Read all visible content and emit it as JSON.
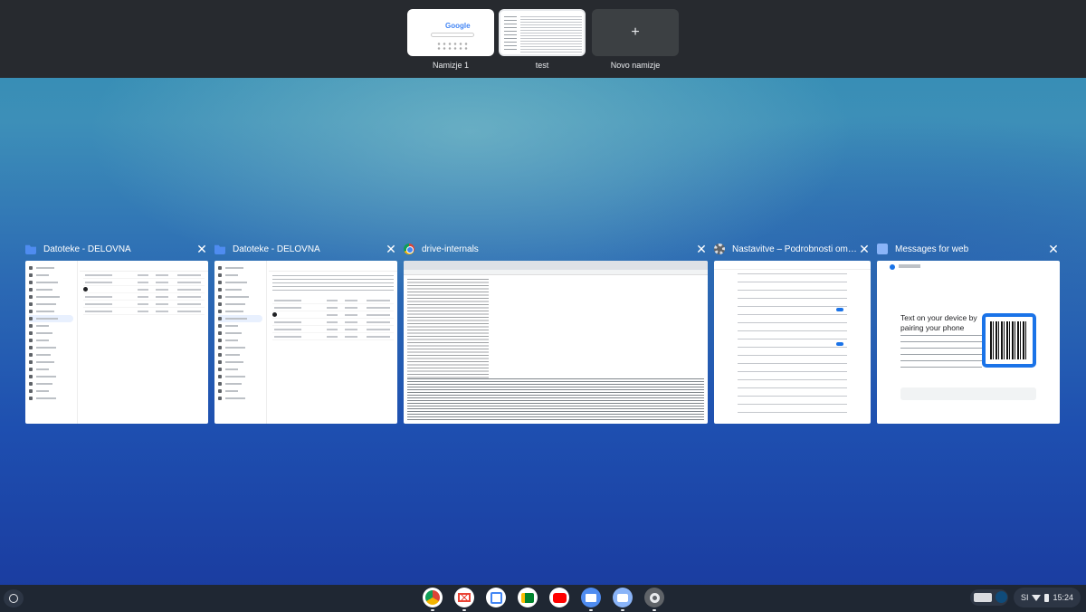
{
  "desks": {
    "items": [
      {
        "label": "Namizje 1"
      },
      {
        "label": "test"
      },
      {
        "label": "Novo namizje",
        "icon": "+"
      }
    ]
  },
  "windows": [
    {
      "title": "Datoteke - DELOVNA",
      "icon": "folder-icon",
      "close": "✕"
    },
    {
      "title": "Datoteke - DELOVNA",
      "icon": "folder-icon",
      "close": "✕"
    },
    {
      "title": "drive-internals",
      "icon": "chrome-icon",
      "close": "✕"
    },
    {
      "title": "Nastavitve – Podrobnosti omre...",
      "icon": "settings-icon",
      "close": "✕"
    },
    {
      "title": "Messages for web",
      "icon": "messages-icon",
      "close": "✕"
    }
  ],
  "messages_preview": {
    "heading": "Text on your device by pairing your phone"
  },
  "shelf": {
    "apps": [
      {
        "name": "chrome",
        "color": "#ffffff"
      },
      {
        "name": "gmail",
        "color": "#ffffff"
      },
      {
        "name": "calendar",
        "color": "#ffffff"
      },
      {
        "name": "meet",
        "color": "#ffffff"
      },
      {
        "name": "youtube",
        "color": "#ffffff"
      },
      {
        "name": "files",
        "color": "#4f8cf0"
      },
      {
        "name": "messages",
        "color": "#8ab4f8"
      },
      {
        "name": "settings",
        "color": "#5f6368"
      }
    ],
    "status": {
      "locale": "SI",
      "time": "15:24"
    }
  }
}
